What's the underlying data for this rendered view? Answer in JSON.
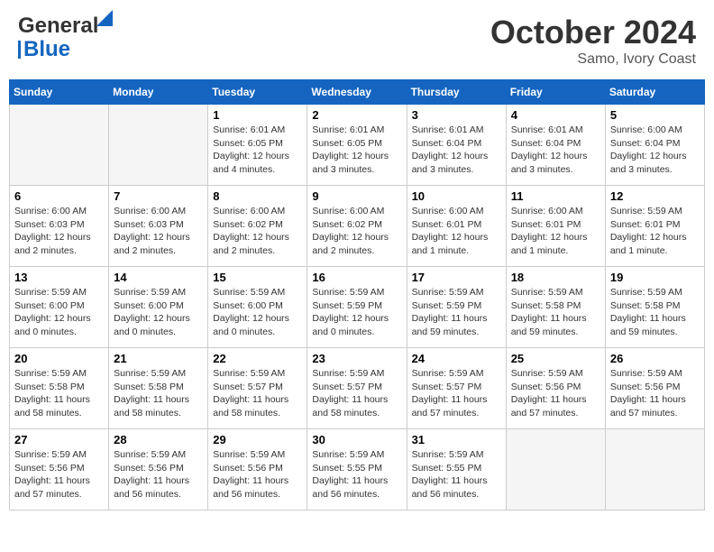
{
  "header": {
    "logo_line1": "General",
    "logo_line2": "Blue",
    "month": "October 2024",
    "location": "Samo, Ivory Coast"
  },
  "weekdays": [
    "Sunday",
    "Monday",
    "Tuesday",
    "Wednesday",
    "Thursday",
    "Friday",
    "Saturday"
  ],
  "weeks": [
    [
      {
        "day": "",
        "info": ""
      },
      {
        "day": "",
        "info": ""
      },
      {
        "day": "1",
        "info": "Sunrise: 6:01 AM\nSunset: 6:05 PM\nDaylight: 12 hours\nand 4 minutes."
      },
      {
        "day": "2",
        "info": "Sunrise: 6:01 AM\nSunset: 6:05 PM\nDaylight: 12 hours\nand 3 minutes."
      },
      {
        "day": "3",
        "info": "Sunrise: 6:01 AM\nSunset: 6:04 PM\nDaylight: 12 hours\nand 3 minutes."
      },
      {
        "day": "4",
        "info": "Sunrise: 6:01 AM\nSunset: 6:04 PM\nDaylight: 12 hours\nand 3 minutes."
      },
      {
        "day": "5",
        "info": "Sunrise: 6:00 AM\nSunset: 6:04 PM\nDaylight: 12 hours\nand 3 minutes."
      }
    ],
    [
      {
        "day": "6",
        "info": "Sunrise: 6:00 AM\nSunset: 6:03 PM\nDaylight: 12 hours\nand 2 minutes."
      },
      {
        "day": "7",
        "info": "Sunrise: 6:00 AM\nSunset: 6:03 PM\nDaylight: 12 hours\nand 2 minutes."
      },
      {
        "day": "8",
        "info": "Sunrise: 6:00 AM\nSunset: 6:02 PM\nDaylight: 12 hours\nand 2 minutes."
      },
      {
        "day": "9",
        "info": "Sunrise: 6:00 AM\nSunset: 6:02 PM\nDaylight: 12 hours\nand 2 minutes."
      },
      {
        "day": "10",
        "info": "Sunrise: 6:00 AM\nSunset: 6:01 PM\nDaylight: 12 hours\nand 1 minute."
      },
      {
        "day": "11",
        "info": "Sunrise: 6:00 AM\nSunset: 6:01 PM\nDaylight: 12 hours\nand 1 minute."
      },
      {
        "day": "12",
        "info": "Sunrise: 5:59 AM\nSunset: 6:01 PM\nDaylight: 12 hours\nand 1 minute."
      }
    ],
    [
      {
        "day": "13",
        "info": "Sunrise: 5:59 AM\nSunset: 6:00 PM\nDaylight: 12 hours\nand 0 minutes."
      },
      {
        "day": "14",
        "info": "Sunrise: 5:59 AM\nSunset: 6:00 PM\nDaylight: 12 hours\nand 0 minutes."
      },
      {
        "day": "15",
        "info": "Sunrise: 5:59 AM\nSunset: 6:00 PM\nDaylight: 12 hours\nand 0 minutes."
      },
      {
        "day": "16",
        "info": "Sunrise: 5:59 AM\nSunset: 5:59 PM\nDaylight: 12 hours\nand 0 minutes."
      },
      {
        "day": "17",
        "info": "Sunrise: 5:59 AM\nSunset: 5:59 PM\nDaylight: 11 hours\nand 59 minutes."
      },
      {
        "day": "18",
        "info": "Sunrise: 5:59 AM\nSunset: 5:58 PM\nDaylight: 11 hours\nand 59 minutes."
      },
      {
        "day": "19",
        "info": "Sunrise: 5:59 AM\nSunset: 5:58 PM\nDaylight: 11 hours\nand 59 minutes."
      }
    ],
    [
      {
        "day": "20",
        "info": "Sunrise: 5:59 AM\nSunset: 5:58 PM\nDaylight: 11 hours\nand 58 minutes."
      },
      {
        "day": "21",
        "info": "Sunrise: 5:59 AM\nSunset: 5:58 PM\nDaylight: 11 hours\nand 58 minutes."
      },
      {
        "day": "22",
        "info": "Sunrise: 5:59 AM\nSunset: 5:57 PM\nDaylight: 11 hours\nand 58 minutes."
      },
      {
        "day": "23",
        "info": "Sunrise: 5:59 AM\nSunset: 5:57 PM\nDaylight: 11 hours\nand 58 minutes."
      },
      {
        "day": "24",
        "info": "Sunrise: 5:59 AM\nSunset: 5:57 PM\nDaylight: 11 hours\nand 57 minutes."
      },
      {
        "day": "25",
        "info": "Sunrise: 5:59 AM\nSunset: 5:56 PM\nDaylight: 11 hours\nand 57 minutes."
      },
      {
        "day": "26",
        "info": "Sunrise: 5:59 AM\nSunset: 5:56 PM\nDaylight: 11 hours\nand 57 minutes."
      }
    ],
    [
      {
        "day": "27",
        "info": "Sunrise: 5:59 AM\nSunset: 5:56 PM\nDaylight: 11 hours\nand 57 minutes."
      },
      {
        "day": "28",
        "info": "Sunrise: 5:59 AM\nSunset: 5:56 PM\nDaylight: 11 hours\nand 56 minutes."
      },
      {
        "day": "29",
        "info": "Sunrise: 5:59 AM\nSunset: 5:56 PM\nDaylight: 11 hours\nand 56 minutes."
      },
      {
        "day": "30",
        "info": "Sunrise: 5:59 AM\nSunset: 5:55 PM\nDaylight: 11 hours\nand 56 minutes."
      },
      {
        "day": "31",
        "info": "Sunrise: 5:59 AM\nSunset: 5:55 PM\nDaylight: 11 hours\nand 56 minutes."
      },
      {
        "day": "",
        "info": ""
      },
      {
        "day": "",
        "info": ""
      }
    ]
  ]
}
